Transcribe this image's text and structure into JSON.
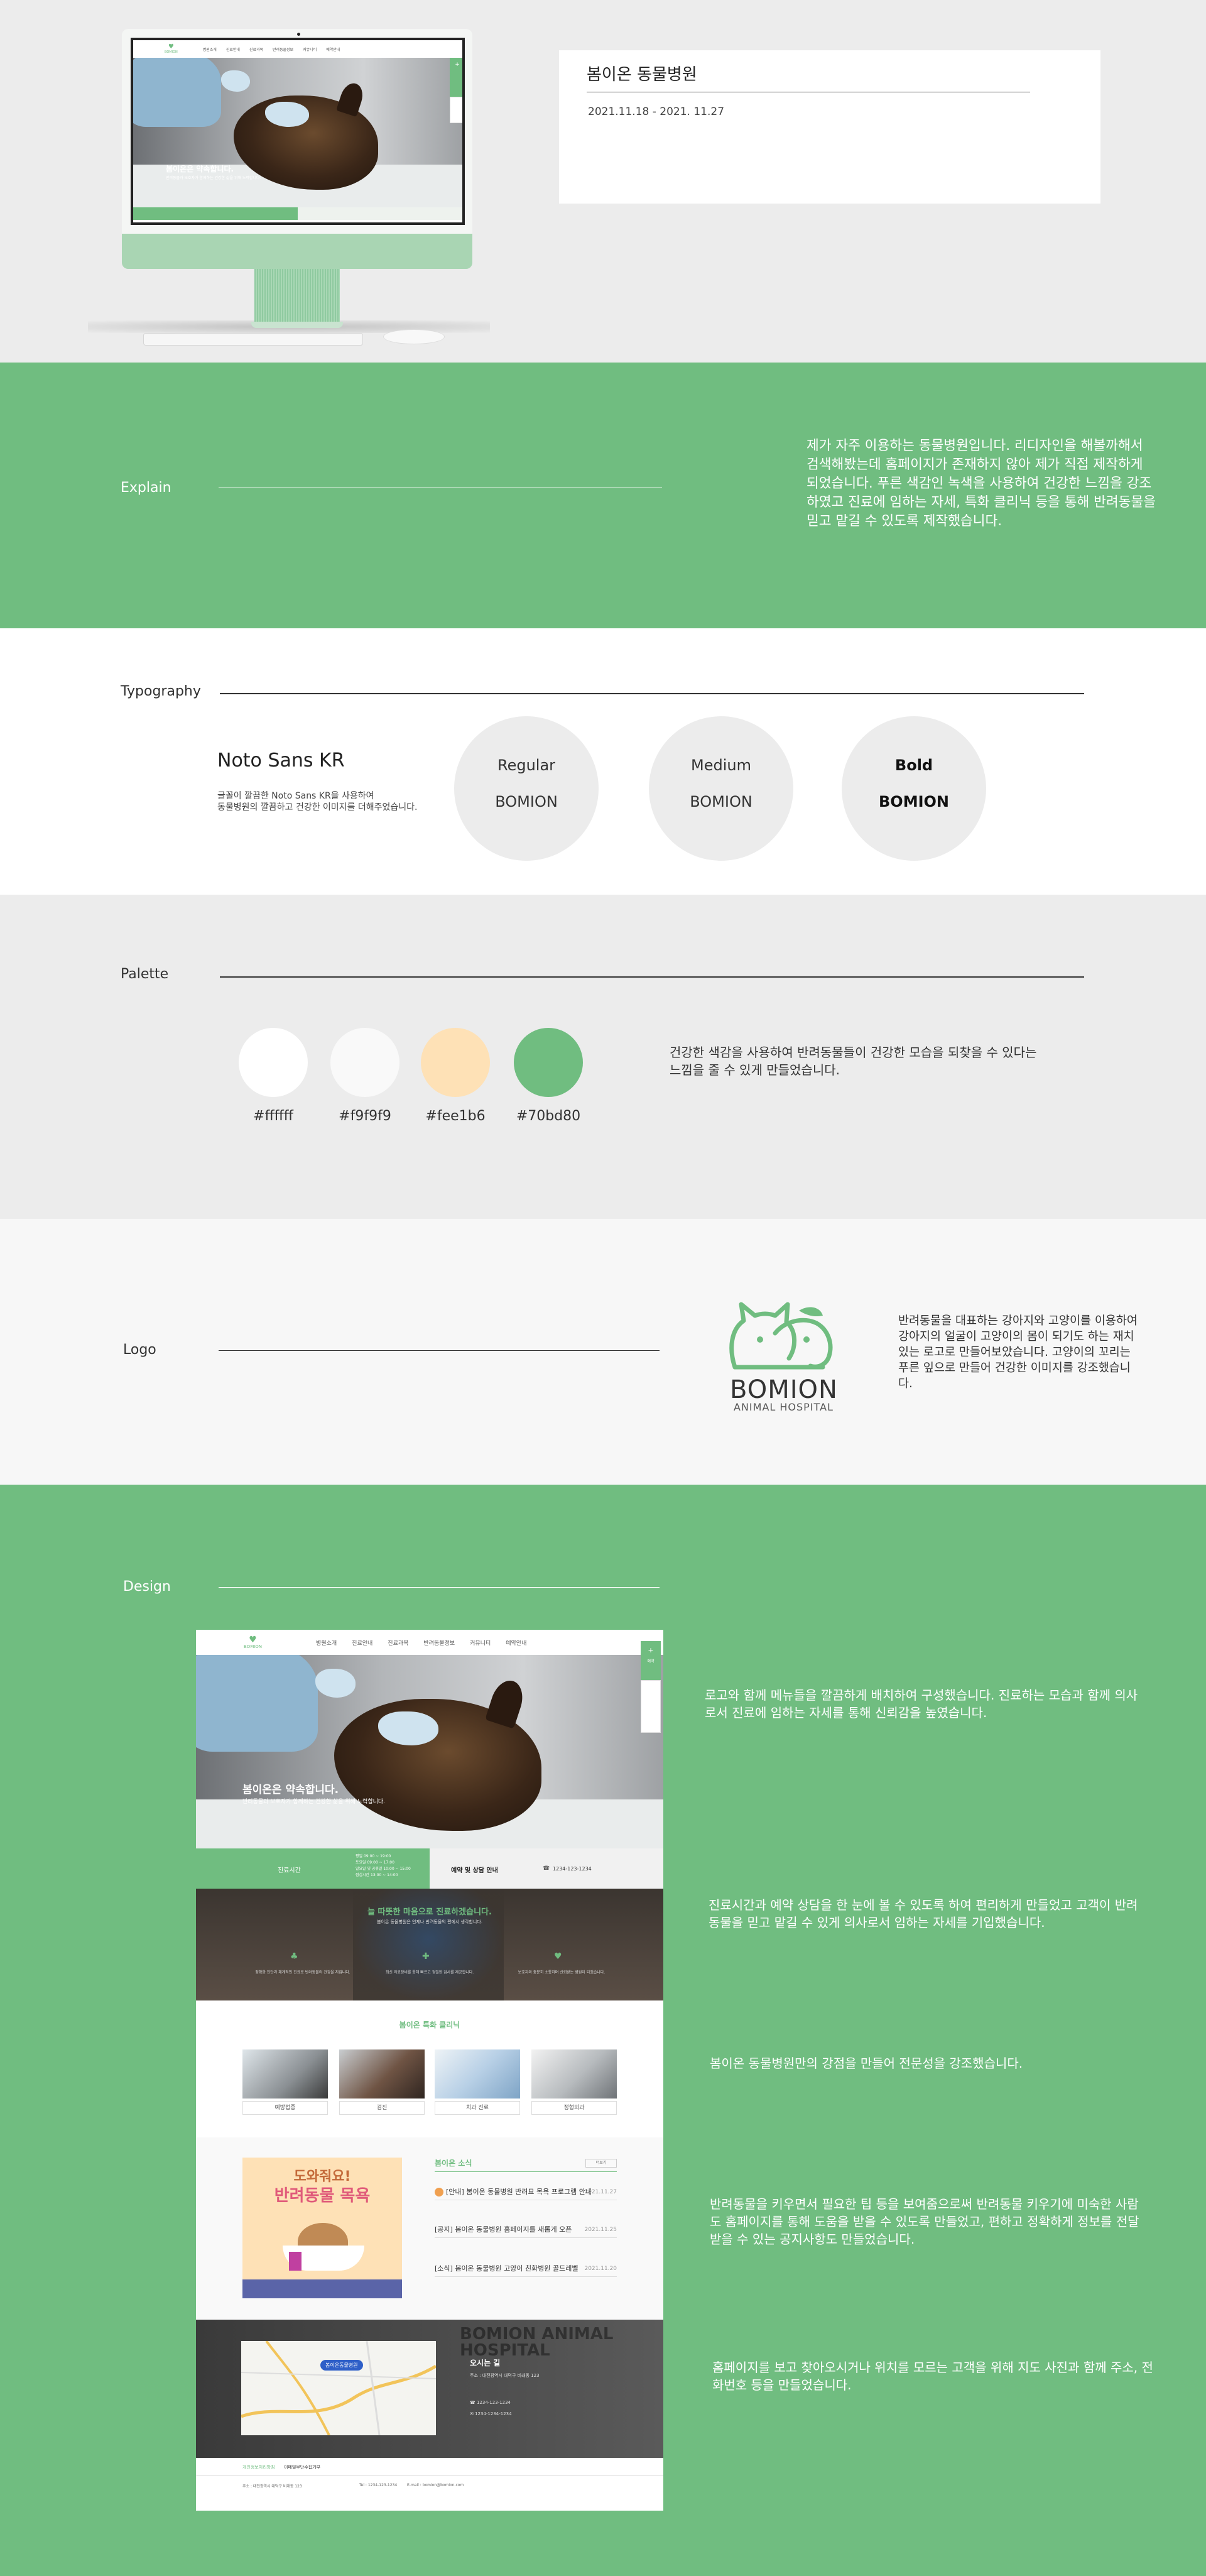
{
  "project": {
    "title": "봄이온 동물병원",
    "period": "2021.11.18 - 2021. 11.27"
  },
  "site": {
    "logo_text": "BOMION",
    "nav": [
      "병원소개",
      "진료안내",
      "진료과목",
      "반려동물정보",
      "커뮤니티",
      "예약안내"
    ],
    "hero_title": "봄이온은 약속합니다.",
    "hero_sub": "반려동물과 보호자가 함께하는 건강한 삶을 위해 노력합니다.",
    "quick_label": "예약",
    "hours_label": "진료시간",
    "hours_lines": [
      "평일 09:00 ~ 19:00",
      "토요일 09:00 ~ 17:00",
      "일요일 및 공휴일 10:00 ~ 15:00",
      "점심시간 13:00 ~ 14:00"
    ],
    "booking_label": "예약 및 상담 안내",
    "phone": "1234-123-1234",
    "care_title": "늘 따뜻한 마음으로 진료하겠습니다.",
    "care_sub": "봄이온 동물병원은 언제나 반려동물의 편에서 생각합니다.",
    "care_items": [
      "정확한 진단과 체계적인 진료로 반려동물의 건강을 지킵니다.",
      "최신 의료장비를 통해 빠르고 정밀한 검사를 제공합니다.",
      "보호자와 충분히 소통하며 신뢰받는 병원이 되겠습니다."
    ],
    "clinic_title": "봄이온 특화 클리닉",
    "clinic_items": [
      "예방접종",
      "검진",
      "치과 진료",
      "정형외과"
    ],
    "notice_banner_l1": "도와줘요!",
    "notice_banner_l2": "반려동물 목욕",
    "notice_title": "봄이온 소식",
    "notice_more": "더보기",
    "notices": [
      {
        "t": "[안내] 봄이온 동물병원 반려묘 목욕 프로그램 안내",
        "d": "2021.11.27"
      },
      {
        "t": "[공지] 봄이온 동물병원 홈페이지를 새롭게 오픈",
        "d": "2021.11.25"
      },
      {
        "t": "[소식] 봄이온 동물병원 고양이 친화병원 골드레벨",
        "d": "2021.11.20"
      }
    ],
    "map_badge": "봄이온동물병원",
    "map_watermark": "BOMION ANIMAL HOSPITAL",
    "location_title": "오시는 길",
    "location_addr": "주소 : 대전광역시 대덕구 비래동 123",
    "location_tel": "1234-123-1234",
    "location_fax": "1234-1234-1234",
    "footer_links": [
      "개인정보처리방침",
      "이메일무단수집거부"
    ],
    "footer_info": [
      "주소 : 대전광역시 대덕구 비래동 123",
      "Tel : 1234-123-1234",
      "E-mail : bomion@bomion.com"
    ]
  },
  "explain": {
    "label": "Explain",
    "text": "제가 자주 이용하는 동물병원입니다. 리디자인을 해볼까해서 검색해봤는데 홈페이지가 존재하지 않아 제가 직접 제작하게 되었습니다. 푸른 색감인 녹색을 사용하여 건강한 느낌을 강조하였고 진료에 임하는 자세, 특화 클리닉 등을 통해 반려동물을 믿고 맡길 수 있도록 제작했습니다."
  },
  "typography": {
    "label": "Typography",
    "font": "Noto Sans KR",
    "desc_l1": "글꼴이 깔끔한 Noto Sans KR을 사용하여",
    "desc_l2": "동물병원의 깔끔하고 건강한 이미지를 더해주었습니다.",
    "weights": [
      {
        "name": "Regular",
        "sample": "BOMION"
      },
      {
        "name": "Medium",
        "sample": "BOMION"
      },
      {
        "name": "Bold",
        "sample": "BOMION"
      }
    ]
  },
  "palette": {
    "label": "Palette",
    "colors": [
      "#ffffff",
      "#f9f9f9",
      "#fee1b6",
      "#70bd80"
    ],
    "text_l1": "건강한 색감을 사용하여 반려동물들이 건강한 모습을 되찾을 수 있다는",
    "text_l2": "느낌을 줄 수 있게 만들었습니다."
  },
  "logo": {
    "label": "Logo",
    "wordmark": "BOMION",
    "subtitle": "ANIMAL HOSPITAL",
    "brand_color": "#70bd80",
    "text": "반려동물을 대표하는 강아지와 고양이를 이용하여 강아지의 얼굴이 고양이의 몸이 되기도 하는 재치있는 로고로 만들어보았습니다. 고양이의 꼬리는 푸른 잎으로 만들어 건강한 이미지를 강조했습니다."
  },
  "design": {
    "label": "Design",
    "notes": [
      "로고와 함께 메뉴들을 깔끔하게 배치하여 구성했습니다. 진료하는 모습과 함께 의사로서 진료에 임하는 자세를 통해 신뢰감을 높였습니다.",
      "진료시간과 예약 상담을 한 눈에 볼 수 있도록 하여 편리하게 만들었고 고객이 반려동물을 믿고 맡길 수 있게 의사로서 임하는 자세를 기입했습니다.",
      "봄이온 동물병원만의 강점을 만들어 전문성을 강조했습니다.",
      "반려동물을 키우면서 필요한 팁 등을 보여줌으로써 반려동물 키우기에 미숙한 사람 도 홈페이지를 통해 도움을 받을 수 있도록 만들었고, 편하고 정확하게 정보를 전달 받을 수 있는 공지사항도 만들었습니다.",
      "홈페이지를 보고 찾아오시거나 위치를 모르는 고객을 위해 지도 사진과 함께 주소, 전화번호 등을 만들었습니다."
    ]
  }
}
